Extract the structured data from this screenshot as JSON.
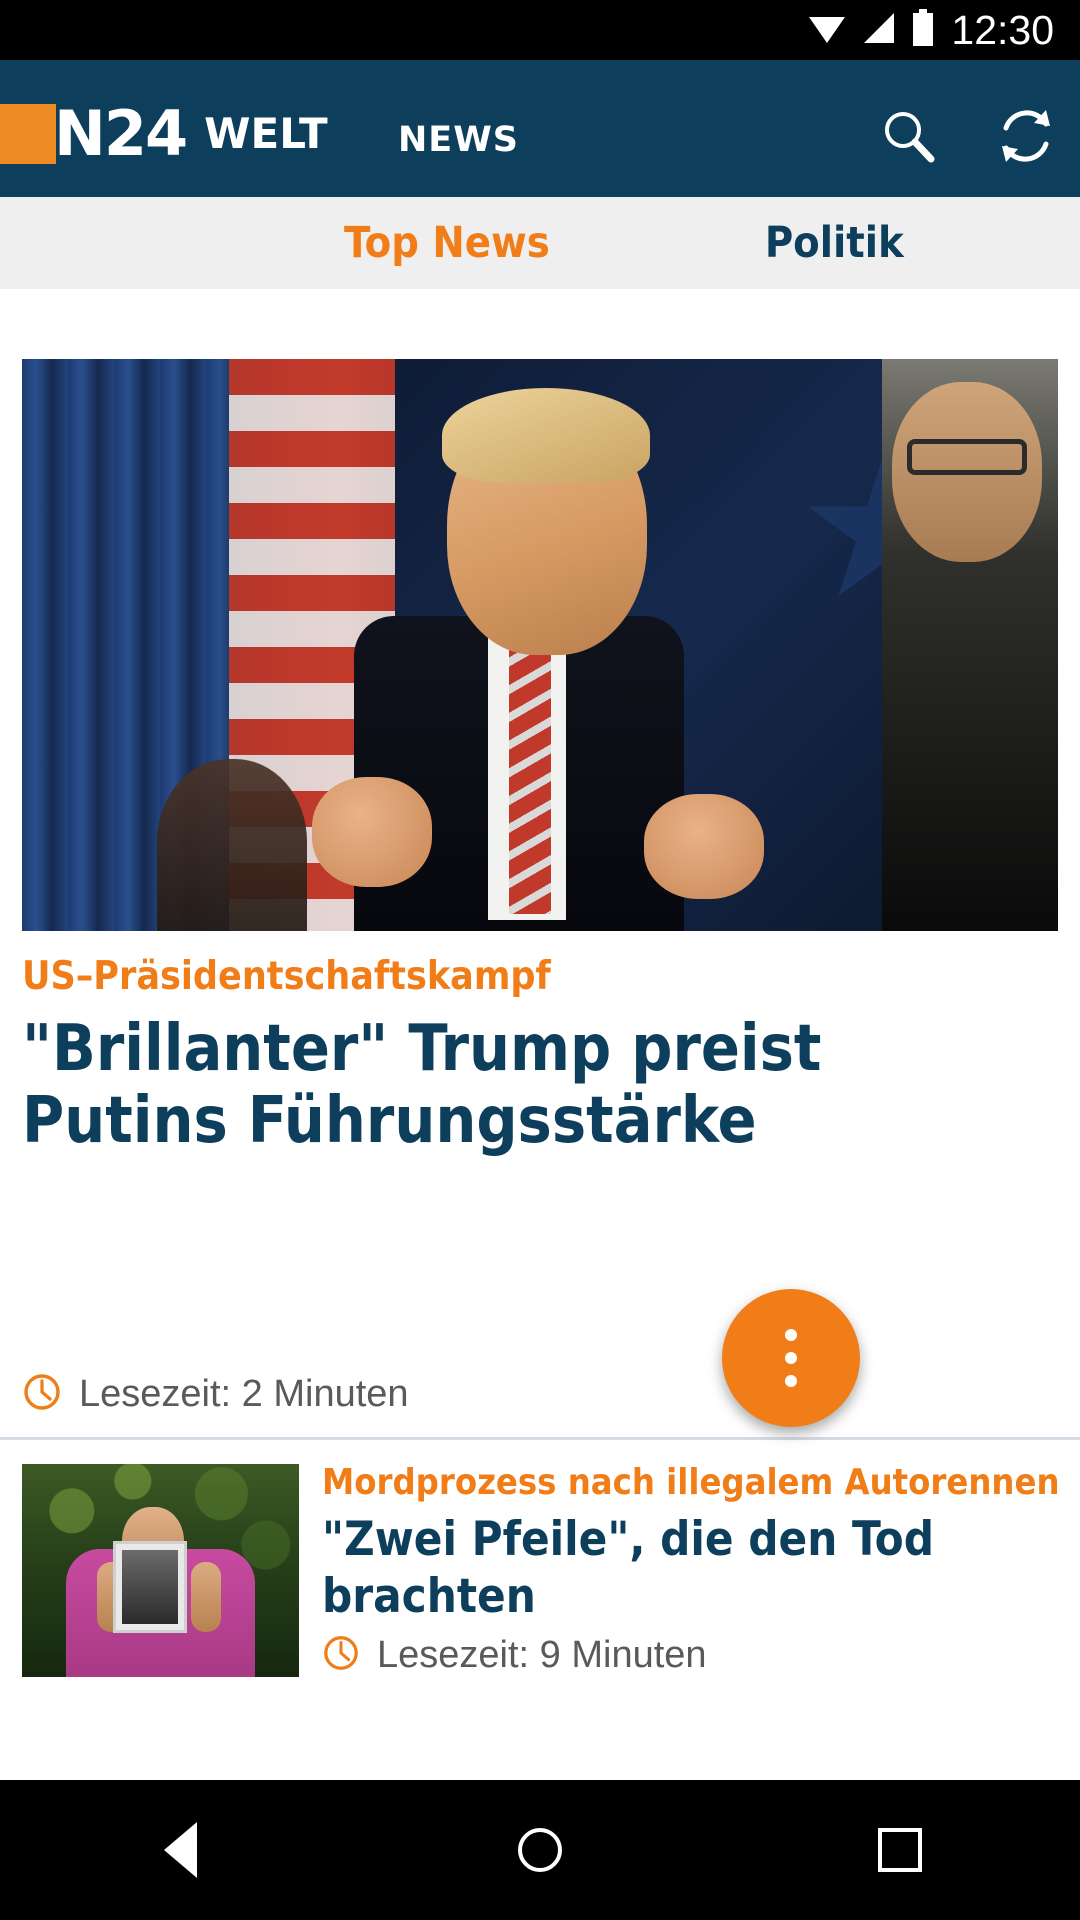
{
  "statusbar": {
    "time": "12:30",
    "icons": [
      "wifi-icon",
      "signal-icon",
      "battery-icon"
    ]
  },
  "appbar": {
    "logo_n24": "N24",
    "logo_welt": "WELT",
    "title": "NEWS",
    "search_icon": "search-icon",
    "refresh_icon": "refresh-icon",
    "background_color": "#0D3F5C",
    "accent_color": "#EE8B22"
  },
  "tabs": [
    {
      "label": "Top News",
      "active": true
    },
    {
      "label": "Politik",
      "active": false
    }
  ],
  "articles": [
    {
      "kicker": "US–Präsidentschaftskampf",
      "headline": "\"Brillanter\" Trump preist Putins Führungsstärke",
      "readtime": "Lesezeit: 2 Minuten",
      "clock_icon": "clock-icon",
      "image": "trump-press-conference-photo"
    },
    {
      "kicker": "Mordprozess nach illegalem Autorennen",
      "headline": "\"Zwei Pfeile\", die den Tod brachten",
      "readtime": "Lesezeit: 9 Minuten",
      "clock_icon": "clock-icon",
      "image": "man-holding-photo-frame-thumbnail"
    }
  ],
  "fab": {
    "icon": "more-vertical-icon",
    "color": "#F07D17"
  },
  "navbar": {
    "back": "back-triangle-icon",
    "home": "home-circle-icon",
    "recents": "recents-square-icon"
  },
  "colors": {
    "header_blue": "#0D3F5C",
    "orange": "#F07D17",
    "tabbar_gray": "#EFEFEF",
    "readtime_gray": "#5A5A5A"
  }
}
